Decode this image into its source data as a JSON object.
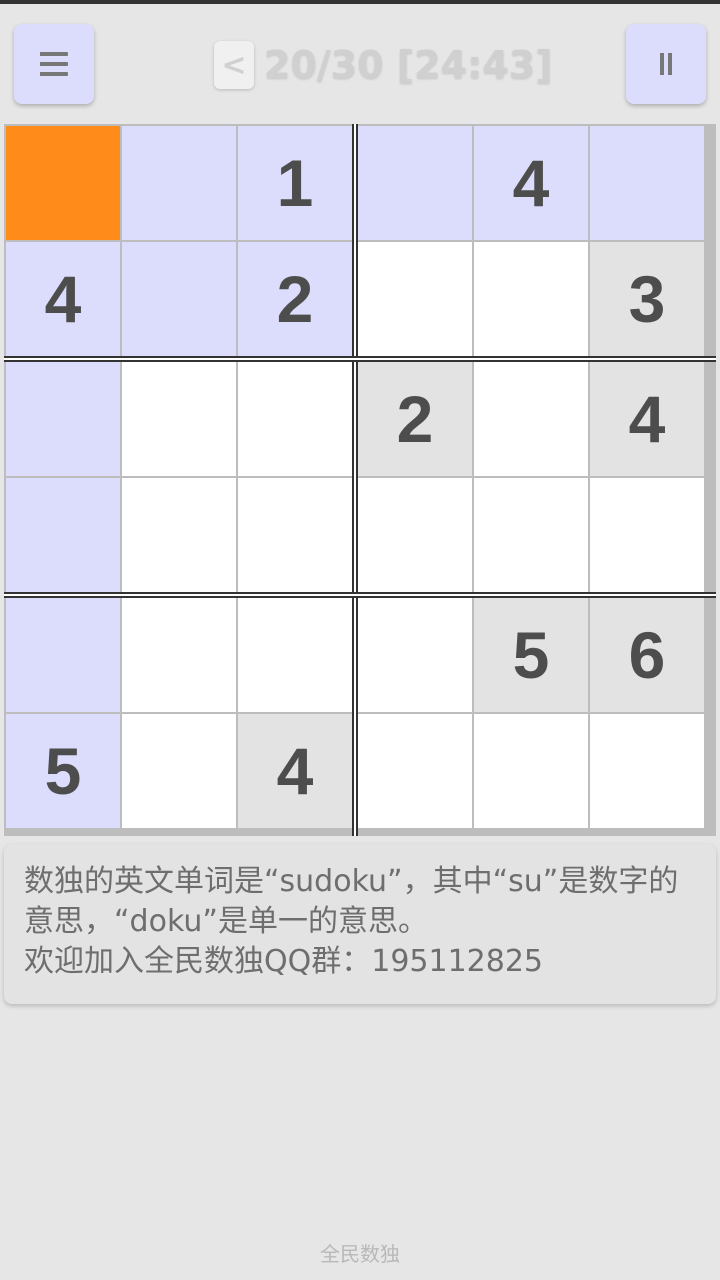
{
  "header": {
    "menu_icon": "menu-icon",
    "prev_label": "<",
    "title": "20/30 [24:43]",
    "pause_icon": "pause-icon"
  },
  "board": {
    "rows": [
      [
        {
          "v": "",
          "s": "selected"
        },
        {
          "v": "",
          "s": "highlight"
        },
        {
          "v": "1",
          "s": "highlight"
        },
        {
          "v": "",
          "s": "highlight"
        },
        {
          "v": "4",
          "s": "highlight"
        },
        {
          "v": "",
          "s": "highlight"
        }
      ],
      [
        {
          "v": "4",
          "s": "highlight"
        },
        {
          "v": "",
          "s": "highlight"
        },
        {
          "v": "2",
          "s": "highlight"
        },
        {
          "v": "",
          "s": "empty"
        },
        {
          "v": "",
          "s": "empty"
        },
        {
          "v": "3",
          "s": "given"
        }
      ],
      [
        {
          "v": "",
          "s": "highlight"
        },
        {
          "v": "",
          "s": "empty"
        },
        {
          "v": "",
          "s": "empty"
        },
        {
          "v": "2",
          "s": "given"
        },
        {
          "v": "",
          "s": "empty"
        },
        {
          "v": "4",
          "s": "given"
        }
      ],
      [
        {
          "v": "",
          "s": "highlight"
        },
        {
          "v": "",
          "s": "empty"
        },
        {
          "v": "",
          "s": "empty"
        },
        {
          "v": "",
          "s": "empty"
        },
        {
          "v": "",
          "s": "empty"
        },
        {
          "v": "",
          "s": "empty"
        }
      ],
      [
        {
          "v": "",
          "s": "highlight"
        },
        {
          "v": "",
          "s": "empty"
        },
        {
          "v": "",
          "s": "empty"
        },
        {
          "v": "",
          "s": "empty"
        },
        {
          "v": "5",
          "s": "given"
        },
        {
          "v": "6",
          "s": "given"
        }
      ],
      [
        {
          "v": "5",
          "s": "highlight"
        },
        {
          "v": "",
          "s": "empty"
        },
        {
          "v": "4",
          "s": "given"
        },
        {
          "v": "",
          "s": "empty"
        },
        {
          "v": "",
          "s": "empty"
        },
        {
          "v": "",
          "s": "empty"
        }
      ]
    ]
  },
  "info": {
    "line1": "数独的英文单词是“sudoku”，其中“su”是数字的",
    "line2": "意思，“doku”是单一的意思。",
    "line3": "欢迎加入全民数独QQ群：195112825"
  },
  "footer": {
    "app_name": "全民数独"
  },
  "colors": {
    "selected": "#ff8c1a",
    "highlight": "#dcdcfc",
    "given": "#e3e3e3",
    "empty": "#ffffff"
  }
}
